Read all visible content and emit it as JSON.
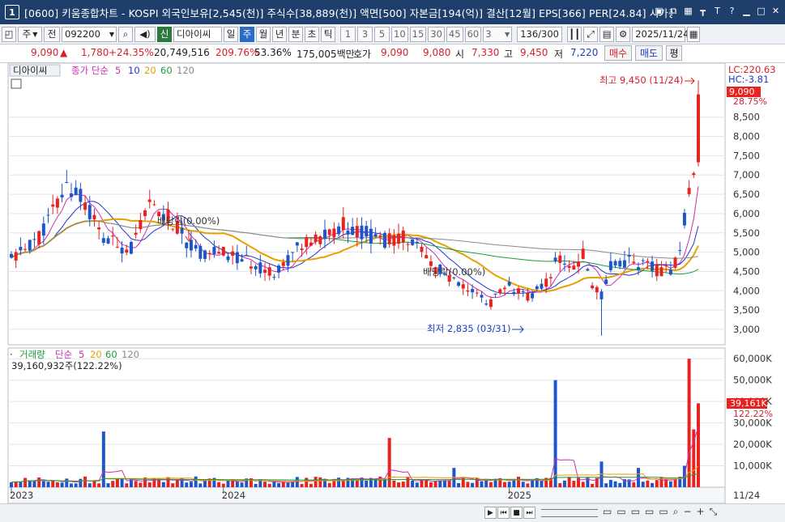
{
  "window": {
    "number": "1",
    "title": "[0600] 키움종합차트 - KOSPI 외국인보유[2,545(천)] 주식수[38,889(천)] 액면[500] 자본금[194(억)] 결산[12월] EPS[366] PER[24.84] 시가총"
  },
  "toolbar": {
    "period_1": "주",
    "period_2": "전",
    "code": "092200",
    "badge": "신",
    "stock_name": "디아이씨",
    "tabs": [
      "일",
      "주",
      "월",
      "년",
      "분",
      "초",
      "틱"
    ],
    "active_tab": "주",
    "numbers": [
      "1",
      "3",
      "5",
      "10",
      "15",
      "30",
      "45",
      "60"
    ],
    "count_select": "3",
    "count_value": "136",
    "count_total": "/300",
    "date": "2025/11/24"
  },
  "quote": {
    "price": "9,090",
    "arrow": "▲",
    "change": "1,780",
    "change_pct": "+24.35%",
    "volume": "20,749,516",
    "volume_ratio": "209.76%",
    "turnover": "53.36%",
    "amount": "175,005백만",
    "hoga_label": "호가",
    "hoga_ask": "9,090",
    "hoga_bid": "9,080",
    "open_label": "시",
    "open": "7,330",
    "high_label": "고",
    "high": "9,450",
    "low_label": "저",
    "low": "7,220",
    "buy_label": "매수",
    "sell_label": "매도",
    "avg_label": "평"
  },
  "price_panel": {
    "name": "디아이씨",
    "ma_label": "종가 단순",
    "ma_periods": [
      "5",
      "10",
      "20",
      "60",
      "120"
    ],
    "ma_colors": [
      "#cc2db4",
      "#2433c4",
      "#e6a000",
      "#1e9a3a",
      "#8a8a8a"
    ],
    "lc": "LC:220.63",
    "hc": "HC:-3.81",
    "current_price": "9,090",
    "current_pct": "28.75%",
    "max_label": "최고 9,450 (11/24)",
    "min_label": "최저 2,835 (03/31)",
    "dividend_1": "배당락(0.00%)",
    "dividend_2": "배당락(0.00%)"
  },
  "volume_panel": {
    "name": "거래량",
    "ma_label": "단순",
    "ma_periods": [
      "5",
      "20",
      "60",
      "120"
    ],
    "info": "39,160,932주(122.22%)",
    "current_value": "39,161K",
    "current_pct": "122.22%"
  },
  "x_axis": {
    "labels": [
      "2023",
      "2024",
      "2025"
    ],
    "last": "11/24"
  },
  "colors": {
    "up": "#e8231f",
    "down": "#1e55c8",
    "title_bg": "#1e3f6b"
  },
  "chart_data": {
    "type": "candlestick",
    "interval": "weekly",
    "y_price_ticks": [
      3000,
      3500,
      4000,
      4500,
      5000,
      5500,
      6000,
      6500,
      7000,
      7500,
      8000,
      8500
    ],
    "y_volume_ticks": [
      "10,000K",
      "20,000K",
      "30,000K",
      "40,000K",
      "50,000K",
      "60,000K"
    ],
    "price_range": [
      2600,
      9900
    ],
    "volume_range": [
      0,
      65000
    ],
    "last_close": 9090,
    "high": 9450,
    "low": 2835,
    "weeks": 150
  }
}
